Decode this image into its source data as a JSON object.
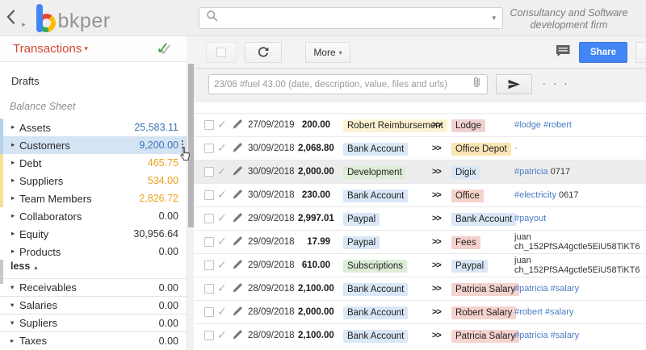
{
  "colors": {
    "accent_red": "#d4492f",
    "share_blue": "#4285f4",
    "tag_blue": "#4a7cc4",
    "amount_blue": "#3c72ba",
    "amount_orange": "#eaa21a",
    "strip_blue": "#b5d2ec",
    "strip_yellow": "#f6e094",
    "selected_row_blue": "#d5e4f4"
  },
  "icons": {
    "collapsed_arrow": "▸",
    "expanded_arrow": "▾",
    "less_up_arrow": "▴",
    "dropdown_caret": "▾",
    "check_mark": "✓",
    "transfer_arrows": ">>",
    "composer_dots": ". . ."
  },
  "header": {
    "logo_text": "bkper",
    "org_line1": "Consultancy and Software",
    "org_line2": "development firm",
    "search_value": ""
  },
  "panel": {
    "title": "Transactions"
  },
  "toolbar": {
    "more_label": "More",
    "share_label": "Share"
  },
  "composer": {
    "placeholder": "23/06 #fuel 43.00 (date, description, value, files and urls)"
  },
  "sidebar": {
    "drafts_label": "Drafts",
    "section_label": "Balance Sheet",
    "less_label": "less",
    "accounts": [
      {
        "name": "Assets",
        "value": "25,583.11",
        "value_class": "blue",
        "strip": "#b5d2ec",
        "selected": false
      },
      {
        "name": "Customers",
        "value": "9,200.00",
        "value_class": "blue",
        "strip": "#b5d2ec",
        "selected": true
      },
      {
        "name": "Debt",
        "value": "465.75",
        "value_class": "orange",
        "strip": "#f6e094",
        "selected": false
      },
      {
        "name": "Suppliers",
        "value": "534.00",
        "value_class": "orange",
        "strip": "#f6e094",
        "selected": false
      },
      {
        "name": "Team Members",
        "value": "2,826.72",
        "value_class": "orange",
        "strip": "#f6e094",
        "selected": false
      },
      {
        "name": "Collaborators",
        "value": "0.00",
        "value_class": "plain",
        "strip": "",
        "selected": false
      },
      {
        "name": "Equity",
        "value": "30,956.64",
        "value_class": "plain",
        "strip": "",
        "selected": false
      },
      {
        "name": "Products",
        "value": "0.00",
        "value_class": "plain",
        "strip": "",
        "selected": false
      }
    ],
    "groups": [
      {
        "name": "Receivables",
        "value": "0.00",
        "expanded": true
      },
      {
        "name": "Salaries",
        "value": "0.00",
        "expanded": true
      },
      {
        "name": "Supliers",
        "value": "0.00",
        "expanded": true
      },
      {
        "name": "Taxes",
        "value": "0.00",
        "expanded": false
      }
    ]
  },
  "transactions": [
    {
      "date": "27/09/2019",
      "amount": "200.00",
      "from": {
        "label": "Robert Reimbursement",
        "color": "#fdf3d2"
      },
      "to": {
        "label": "Lodge",
        "color": "#f0d3d1"
      },
      "desc": [
        {
          "t": "tag",
          "v": "#lodge #robert"
        }
      ],
      "highlighted": false
    },
    {
      "date": "30/09/2018",
      "amount": "2,068.80",
      "from": {
        "label": "Bank Account",
        "color": "#d9e7f6"
      },
      "to": {
        "label": "Office Depot",
        "color": "#fbe5b4"
      },
      "desc": [
        {
          "t": "muted",
          "v": "-"
        }
      ],
      "highlighted": false
    },
    {
      "date": "30/09/2018",
      "amount": "2,000.00",
      "from": {
        "label": "Development",
        "color": "#dcedd8"
      },
      "to": {
        "label": "Digix",
        "color": "#d9e7f6"
      },
      "desc": [
        {
          "t": "tag",
          "v": "#patricia"
        },
        {
          "t": "text",
          "v": " 0717"
        }
      ],
      "highlighted": true
    },
    {
      "date": "30/09/2018",
      "amount": "230.00",
      "from": {
        "label": "Bank Account",
        "color": "#d9e7f6"
      },
      "to": {
        "label": "Office",
        "color": "#f6d2c9"
      },
      "desc": [
        {
          "t": "tag",
          "v": "#electricity"
        },
        {
          "t": "text",
          "v": " 0617"
        }
      ],
      "highlighted": false
    },
    {
      "date": "29/09/2018",
      "amount": "2,997.01",
      "from": {
        "label": "Paypal",
        "color": "#d9e7f6"
      },
      "to": {
        "label": "Bank Account",
        "color": "#d9e7f6"
      },
      "desc": [
        {
          "t": "tag",
          "v": "#payout"
        }
      ],
      "highlighted": false
    },
    {
      "date": "29/09/2018",
      "amount": "17.99",
      "from": {
        "label": "Paypal",
        "color": "#d9e7f6"
      },
      "to": {
        "label": "Fees",
        "color": "#f5d1cd"
      },
      "desc": [
        {
          "t": "text",
          "v": "juan"
        },
        {
          "t": "br"
        },
        {
          "t": "text",
          "v": "ch_152PfSA4gctle5EiU58TiKT6"
        }
      ],
      "highlighted": false
    },
    {
      "date": "29/09/2018",
      "amount": "610.00",
      "from": {
        "label": "Subscriptions",
        "color": "#dcedd8"
      },
      "to": {
        "label": "Paypal",
        "color": "#d9e7f6"
      },
      "desc": [
        {
          "t": "text",
          "v": "juan"
        },
        {
          "t": "br"
        },
        {
          "t": "text",
          "v": "ch_152PfSA4gctle5EiU58TiKT6"
        }
      ],
      "highlighted": false
    },
    {
      "date": "28/09/2018",
      "amount": "2,100.00",
      "from": {
        "label": "Bank Account",
        "color": "#d9e7f6"
      },
      "to": {
        "label": "Patricia Salary",
        "color": "#f5d3cf"
      },
      "desc": [
        {
          "t": "tag",
          "v": "#patricia #salary"
        }
      ],
      "highlighted": false
    },
    {
      "date": "28/09/2018",
      "amount": "2,000.00",
      "from": {
        "label": "Bank Account",
        "color": "#d9e7f6"
      },
      "to": {
        "label": "Robert Salary",
        "color": "#f5d3cf"
      },
      "desc": [
        {
          "t": "tag",
          "v": "#robert #salary"
        }
      ],
      "highlighted": false
    },
    {
      "date": "28/09/2018",
      "amount": "2,100.00",
      "from": {
        "label": "Bank Account",
        "color": "#d9e7f6"
      },
      "to": {
        "label": "Patricia Salary",
        "color": "#f5d3cf"
      },
      "desc": [
        {
          "t": "tag",
          "v": "#patricia #salary"
        }
      ],
      "highlighted": false
    }
  ]
}
